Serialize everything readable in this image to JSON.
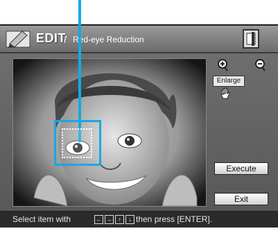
{
  "header": {
    "title": "EDIT",
    "separator": "/",
    "subtitle": "Red-eye Reduction",
    "edit_icon": "edit-pencil-icon",
    "card_icon": "memory-card-icon"
  },
  "tools": {
    "zoom_in_icon": "zoom-in-icon",
    "zoom_out_icon": "zoom-out-icon",
    "enlarge_label": "Enlarge",
    "hand_icon": "hand-icon"
  },
  "buttons": {
    "execute": "Execute",
    "exit": "Exit"
  },
  "status": {
    "prefix": "Select item with",
    "keys": [
      "←",
      "→",
      "↑",
      "↓"
    ],
    "suffix": "then press [ENTER]."
  },
  "colors": {
    "accent": "#19a8e0"
  }
}
